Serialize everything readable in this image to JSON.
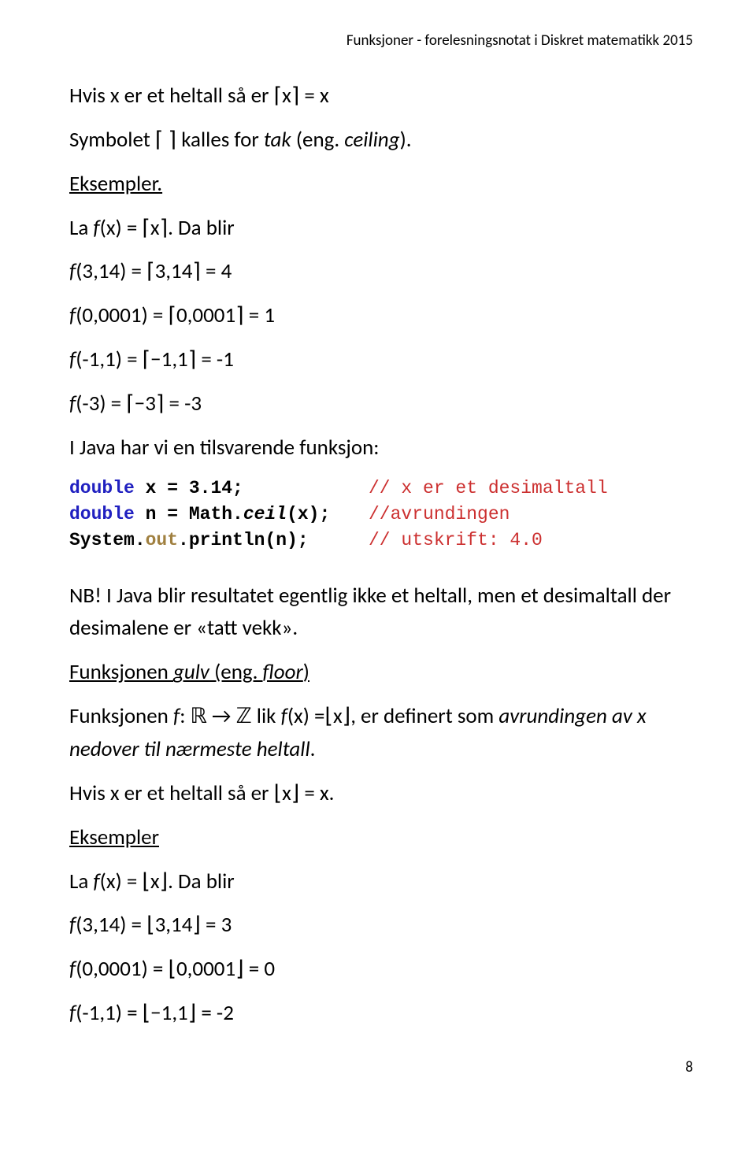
{
  "header": "Funksjoner - forelesningsnotat i Diskret matematikk 2015",
  "t1": "Hvis x er et heltall så er ⌈x⌉ = x",
  "t2_a": "Symbolet ⌈   ⌉ kalles for ",
  "t2_b": "tak",
  "t2_c": " (eng. ",
  "t2_d": "ceiling",
  "t2_e": ").",
  "t3": "Eksempler.",
  "t4_a": "La ",
  "t4_b": "f",
  "t4_c": "(x) = ⌈x⌉. Da blir",
  "t5_a": "f",
  "t5_b": "(3,14) = ⌈3,14⌉ = 4",
  "t6_a": "f",
  "t6_b": "(0,0001) = ⌈0,0001⌉ = 1",
  "t7_a": "f",
  "t7_b": "(-1,1) = ⌈−1,1⌉ = -1",
  "t8_a": "f",
  "t8_b": "(-3) = ⌈−3⌉ = -3",
  "t9": "I Java har vi en tilsvarende funksjon:",
  "code": {
    "r1_kw": "double",
    "r1_rest": " x = 3.14;",
    "r1_comment": "// x er et desimaltall",
    "r2_kw": "double",
    "r2_rest1": " n = Math.",
    "r2_method": "ceil",
    "r2_rest2": "(x);",
    "r2_comment": "//avrundingen",
    "r3_a": "System.",
    "r3_out": "out",
    "r3_b": ".println(n);",
    "r3_comment": "// utskrift: 4.0"
  },
  "t10": "NB! I Java blir resultatet egentlig ikke et heltall, men et desimaltall der desimalene er «tatt vekk».",
  "t11_a": "Funksjonen ",
  "t11_b": "gulv",
  "t11_c": " (eng. ",
  "t11_d": "floor",
  "t11_e": ")",
  "t12_a": "Funksjonen ",
  "t12_b": "f",
  "t12_c": ": ℝ → ℤ  lik ",
  "t12_d": "f",
  "t12_e": "(x) =⌊x⌋, er definert som ",
  "t12_f": "avrundingen av x nedover til nærmeste heltall",
  "t12_g": ".",
  "t13": "Hvis x er et heltall så er ⌊x⌋ = x.",
  "t14": "Eksempler",
  "t15_a": "La ",
  "t15_b": "f",
  "t15_c": "(x) = ⌊x⌋. Da blir",
  "t16_a": "f",
  "t16_b": "(3,14) = ⌊3,14⌋  = 3",
  "t17_a": "f",
  "t17_b": "(0,0001) = ⌊0,0001⌋ = 0",
  "t18_a": "f",
  "t18_b": "(-1,1) = ⌊−1,1⌋ = -2",
  "page_number": "8"
}
